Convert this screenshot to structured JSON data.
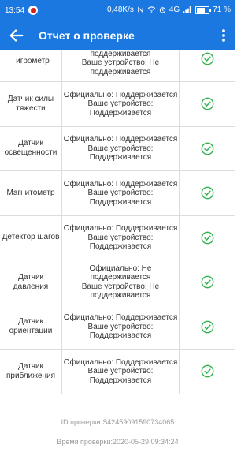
{
  "status_bar": {
    "time": "13:54",
    "net_speed": "0,48K/s",
    "network": "4G",
    "battery": "71 %",
    "battery_level": 0.71
  },
  "appbar": {
    "title": "Отчет о проверке"
  },
  "rows": [
    {
      "name": "Гигрометр",
      "official": "Официально: Не поддерживается",
      "device": "Ваше устройство: Не поддерживается"
    },
    {
      "name": "Датчик силы тяжести",
      "official": "Официально: Поддерживается",
      "device": "Ваше устройство: Поддерживается"
    },
    {
      "name": "Датчик освещенности",
      "official": "Официально: Поддерживается",
      "device": "Ваше устройство: Поддерживается"
    },
    {
      "name": "Магнитометр",
      "official": "Официально: Поддерживается",
      "device": "Ваше устройство: Поддерживается"
    },
    {
      "name": "Детектор шагов",
      "official": "Официально: Поддерживается",
      "device": "Ваше устройство: Поддерживается"
    },
    {
      "name": "Датчик давления",
      "official": "Официально: Не поддерживается",
      "device": "Ваше устройство: Не поддерживается"
    },
    {
      "name": "Датчик ориентации",
      "official": "Официально: Поддерживается",
      "device": "Ваше устройство: Поддерживается"
    },
    {
      "name": "Датчик приближения",
      "official": "Официально: Поддерживается",
      "device": "Ваше устройство: Поддерживается"
    }
  ],
  "footer": {
    "check_id": "ID проверки:S42459091590734065",
    "check_time": "Время проверки:2020-05-29 09:34:24"
  },
  "colors": {
    "primary": "#1b78e0",
    "success": "#2fb24c",
    "divider": "#dcdcdc"
  }
}
